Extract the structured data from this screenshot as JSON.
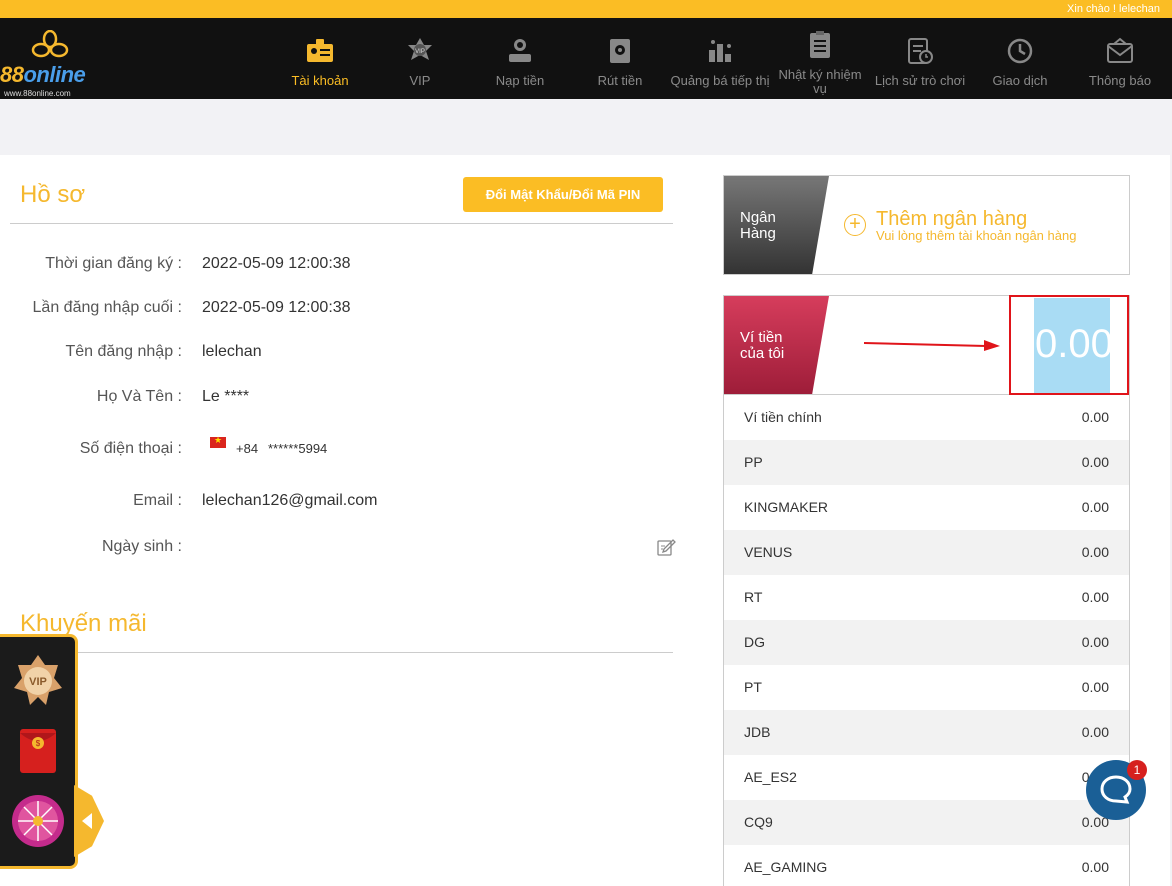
{
  "topbar": {
    "greeting": "Xin chào ! lelechan"
  },
  "logo": {
    "brand_prefix": "88",
    "brand_rest": "online",
    "url": "www.88online.com"
  },
  "nav": [
    {
      "label": "Tài khoản",
      "icon": "id-card-icon",
      "active": true
    },
    {
      "label": "VIP",
      "icon": "vip-star-icon"
    },
    {
      "label": "Nạp tiền",
      "icon": "deposit-icon"
    },
    {
      "label": "Rút tiền",
      "icon": "withdraw-safe-icon"
    },
    {
      "label": "Quảng bá tiếp thị",
      "icon": "promotion-icon"
    },
    {
      "label": "Nhật ký nhiệm vụ",
      "icon": "task-log-icon"
    },
    {
      "label": "Lịch sử trò chơi",
      "icon": "game-history-icon"
    },
    {
      "label": "Giao dịch",
      "icon": "transaction-icon"
    },
    {
      "label": "Thông báo",
      "icon": "mail-icon"
    }
  ],
  "profile": {
    "title": "Hồ sơ",
    "change_button": "Đổi Mật Khẩu/Đổi Mã PIN",
    "fields": [
      {
        "label": "Thời gian đăng ký :",
        "value": "2022-05-09 12:00:38"
      },
      {
        "label": "Lần đăng nhập cuối :",
        "value": "2022-05-09 12:00:38"
      },
      {
        "label": "Tên đăng nhập :",
        "value": "lelechan"
      },
      {
        "label": "Họ Và Tên :",
        "value": "Le ****"
      },
      {
        "label": "Số điện thoại :",
        "phone_code": "+84",
        "phone_number": "******5994"
      },
      {
        "label": "Email :",
        "value": "lelechan126@gmail.com"
      },
      {
        "label": "Ngày sinh :",
        "value": ""
      }
    ]
  },
  "promotions": {
    "title": "Khuyến mãi"
  },
  "bank": {
    "tab_label": "Ngân Hàng",
    "add_title": "Thêm ngân hàng",
    "add_subtitle": "Vui lòng thêm tài khoản ngân hàng"
  },
  "wallet": {
    "tab_label": "Ví tiền của tôi",
    "total": "0.00",
    "rows": [
      {
        "name": "Ví tiền chính",
        "value": "0.00"
      },
      {
        "name": "PP",
        "value": "0.00"
      },
      {
        "name": "KINGMAKER",
        "value": "0.00"
      },
      {
        "name": "VENUS",
        "value": "0.00"
      },
      {
        "name": "RT",
        "value": "0.00"
      },
      {
        "name": "DG",
        "value": "0.00"
      },
      {
        "name": "PT",
        "value": "0.00"
      },
      {
        "name": "JDB",
        "value": "0.00"
      },
      {
        "name": "AE_ES2",
        "value": "0.00"
      },
      {
        "name": "CQ9",
        "value": "0.00"
      },
      {
        "name": "AE_GAMING",
        "value": "0.00"
      }
    ]
  },
  "chat": {
    "badge": "1"
  },
  "colors": {
    "accent": "#fbbd24",
    "wallet_red": "#c22e4c",
    "highlight_box": "#e0141a",
    "total_highlight": "#a9dcf4"
  }
}
